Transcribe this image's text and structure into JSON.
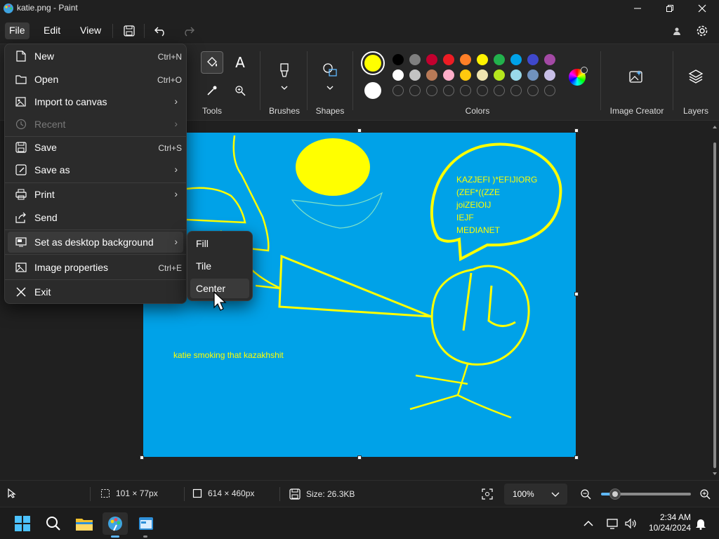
{
  "window": {
    "title": "katie.png - Paint"
  },
  "menubar": {
    "file": "File",
    "edit": "Edit",
    "view": "View"
  },
  "ribbon": {
    "groups": {
      "tools": "Tools",
      "brushes": "Brushes",
      "shapes": "Shapes",
      "colors": "Colors",
      "image_creator": "Image Creator",
      "layers": "Layers"
    },
    "tools_text_glyph": "A",
    "primary_color": "#ffff00",
    "secondary_color": "#ffffff",
    "palette_row1": [
      "#000000",
      "#7f7f7f",
      "#c3002f",
      "#ed1c24",
      "#ff7f27",
      "#fff200",
      "#22b14c",
      "#00a2e8",
      "#3f48cc",
      "#a349a4"
    ],
    "palette_row2": [
      "#ffffff",
      "#c3c3c3",
      "#b97a57",
      "#ffaec9",
      "#ffc90e",
      "#efe4b0",
      "#b5e61d",
      "#99d9ea",
      "#7092be",
      "#c8bfe7"
    ]
  },
  "canvas": {
    "bg_color": "#00a2e8",
    "speech_lines": [
      "KAZJEFI )*EFIJIORG",
      "(ZEF*((ZZE",
      "joiZEIOIJ",
      "IEJF",
      "MEDIANET"
    ],
    "caption": "katie smoking that kazakhshit"
  },
  "file_menu": {
    "items": [
      {
        "label": "New",
        "shortcut": "Ctrl+N",
        "icon": "new-file-icon"
      },
      {
        "label": "Open",
        "shortcut": "Ctrl+O",
        "icon": "folder-open-icon"
      },
      {
        "label": "Import to canvas",
        "icon": "import-icon"
      },
      {
        "label": "Recent",
        "icon": "clock-icon"
      },
      {
        "label": "Save",
        "shortcut": "Ctrl+S",
        "icon": "save-icon"
      },
      {
        "label": "Save as",
        "icon": "save-as-icon"
      },
      {
        "label": "Print",
        "icon": "printer-icon"
      },
      {
        "label": "Send",
        "icon": "share-icon"
      },
      {
        "label": "Set as desktop background",
        "icon": "desktop-icon"
      },
      {
        "label": "Image properties",
        "shortcut": "Ctrl+E",
        "icon": "image-properties-icon"
      },
      {
        "label": "Exit",
        "icon": "close-icon"
      }
    ]
  },
  "submenu": {
    "items": [
      "Fill",
      "Tile",
      "Center"
    ]
  },
  "status": {
    "selection": "101 × 77px",
    "canvas_size": "614 × 460px",
    "file_size": "Size: 26.3KB",
    "zoom": "100%"
  },
  "taskbar": {
    "time": "2:34 AM",
    "date": "10/24/2024"
  }
}
